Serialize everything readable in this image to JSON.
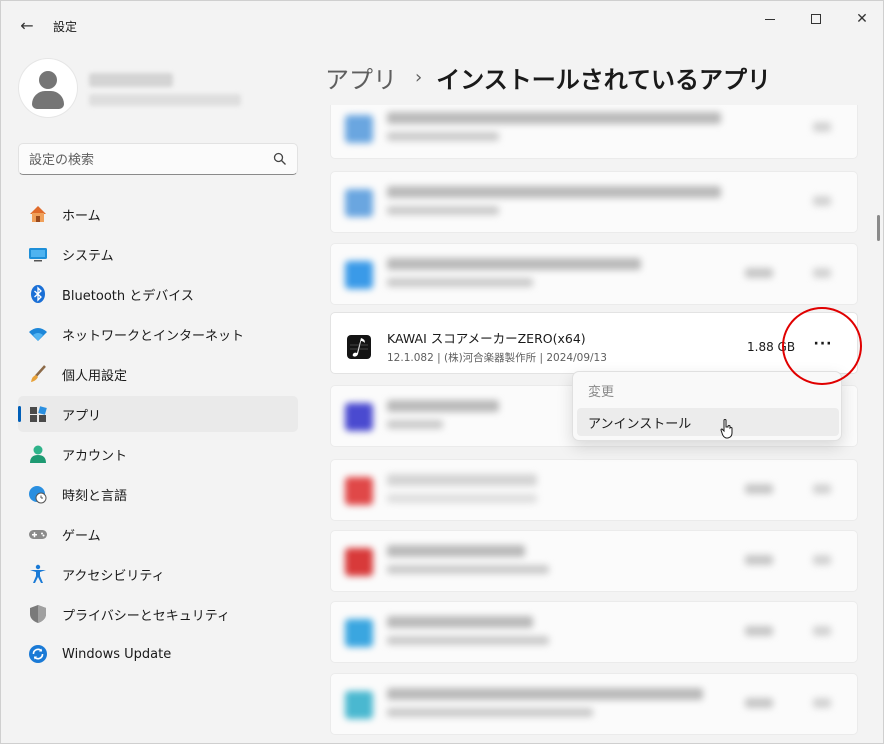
{
  "window": {
    "title": "設定"
  },
  "search": {
    "placeholder": "設定の検索"
  },
  "nav": {
    "items": [
      {
        "label": "ホーム",
        "icon": "home-icon"
      },
      {
        "label": "システム",
        "icon": "display-icon"
      },
      {
        "label": "Bluetooth とデバイス",
        "icon": "bluetooth-icon"
      },
      {
        "label": "ネットワークとインターネット",
        "icon": "wifi-icon"
      },
      {
        "label": "個人用設定",
        "icon": "brush-icon"
      },
      {
        "label": "アプリ",
        "icon": "apps-icon",
        "active": true
      },
      {
        "label": "アカウント",
        "icon": "person-icon"
      },
      {
        "label": "時刻と言語",
        "icon": "globe-clock-icon"
      },
      {
        "label": "ゲーム",
        "icon": "gamepad-icon"
      },
      {
        "label": "アクセシビリティ",
        "icon": "accessibility-icon"
      },
      {
        "label": "プライバシーとセキュリティ",
        "icon": "shield-icon"
      },
      {
        "label": "Windows Update",
        "icon": "update-icon"
      }
    ]
  },
  "breadcrumb": {
    "parent": "アプリ",
    "separator": "›",
    "current": "インストールされているアプリ"
  },
  "focused_app": {
    "name": "KAWAI スコアメーカーZERO(x64)",
    "meta": "12.1.082  |  (株)河合楽器製作所  |  2024/09/13",
    "size": "1.88 GB",
    "more": "···"
  },
  "context_menu": {
    "items": [
      "変更",
      "アンインストール"
    ],
    "disabled_index": 0,
    "hover_index": 1
  },
  "colors": {
    "accent": "#005fb8",
    "annotation": "#e00000"
  }
}
